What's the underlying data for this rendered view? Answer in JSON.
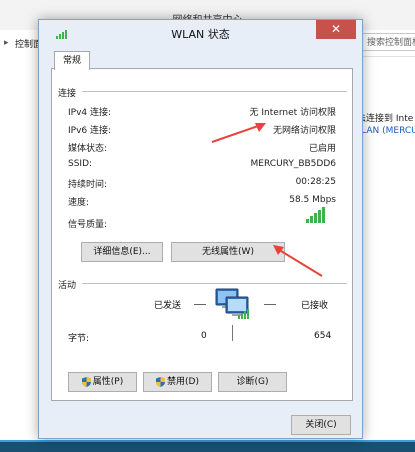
{
  "background": {
    "window_title": "网络和共享中心",
    "breadcrumb": "控制面板",
    "back_arrow": "▸",
    "search_placeholder": "搜索控制面板",
    "right_text_1": "法连接到 Inte",
    "right_text_2": "VLAN (MERCU"
  },
  "dialog": {
    "title": "WLAN 状态",
    "close_glyph": "✕",
    "tab_label": "常规",
    "connection": {
      "section_title": "连接",
      "rows": [
        {
          "label": "IPv4 连接:",
          "value": "无 Internet 访问权限"
        },
        {
          "label": "IPv6 连接:",
          "value": "无网络访问权限"
        },
        {
          "label": "媒体状态:",
          "value": "已启用"
        },
        {
          "label": "SSID:",
          "value": "MERCURY_BB5DD6"
        },
        {
          "label": "持续时间:",
          "value": "00:28:25"
        },
        {
          "label": "速度:",
          "value": "58.5 Mbps"
        }
      ],
      "signal_label": "信号质量:",
      "signal_bars_filled": 5,
      "signal_bars_total": 5,
      "details_button": "详细信息(E)...",
      "wireless_properties_button": "无线属性(W)"
    },
    "activity": {
      "section_title": "活动",
      "sent_label": "已发送",
      "received_label": "已接收",
      "bytes_label": "字节:",
      "bytes_sent": "0",
      "bytes_received": "654"
    },
    "buttons": {
      "properties": "属性(P)",
      "disable": "禁用(D)",
      "diagnose": "诊断(G)",
      "close": "关闭(C)"
    }
  },
  "colors": {
    "close_button": "#c7514c",
    "annotation_arrow": "#e8423a",
    "signal_green": "#3cb44b",
    "link_blue": "#1a5fb4"
  }
}
